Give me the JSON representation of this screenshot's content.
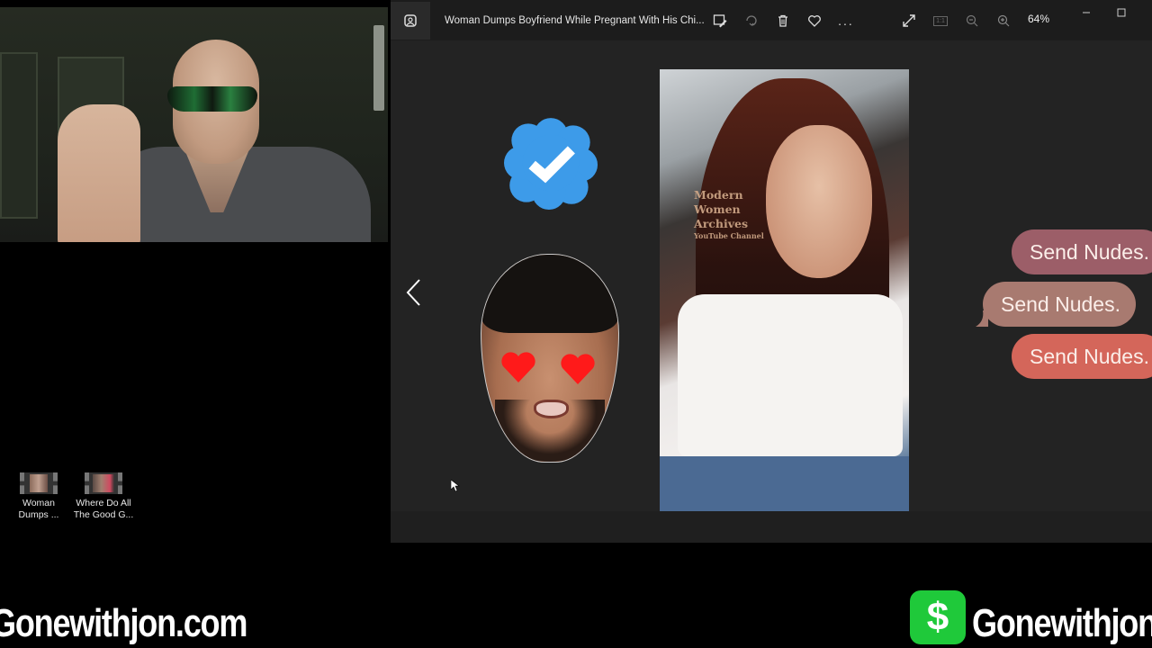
{
  "webcam": {
    "label": "Streamer webcam"
  },
  "desktop": {
    "icons": [
      {
        "label": "Woman Dumps ...",
        "icon": "video-file-icon"
      },
      {
        "label": "Where Do All The Good G...",
        "icon": "video-file-icon"
      }
    ]
  },
  "photos_app": {
    "title": "Woman Dumps Boyfriend While Pregnant With His Chi...",
    "toolbar": {
      "edit": "edit-image-icon",
      "rotate": "rotate-icon",
      "delete": "trash-icon",
      "favorite": "heart-icon",
      "more": "...",
      "fullscreen": "expand-icon",
      "actual_size": "1:1",
      "zoom_out": "zoom-out-icon",
      "zoom_in": "zoom-in-icon",
      "zoom_level": "64%"
    },
    "window_controls": {
      "minimize": "minimize-icon",
      "maximize": "maximize-icon"
    },
    "navigation": {
      "previous": "chevron-left-icon"
    },
    "image": {
      "watermark_lines": [
        "Modern",
        "Women",
        "Archives"
      ],
      "watermark_sub": "YouTube Channel",
      "bubbles": [
        "Send Nudes.",
        "Send Nudes.",
        "Send Nudes."
      ],
      "colors": {
        "bubble1": "#9c5e68",
        "bubble2": "#a87a70",
        "bubble3": "#d4665a",
        "verified": "#3d9be9",
        "heart": "#ff1a1a"
      }
    }
  },
  "overlays": {
    "site_left": "Gonewithjon.com",
    "cashapp_symbol": "$",
    "site_right": "Gonewithjon",
    "cashapp_color": "#1fc93a"
  }
}
